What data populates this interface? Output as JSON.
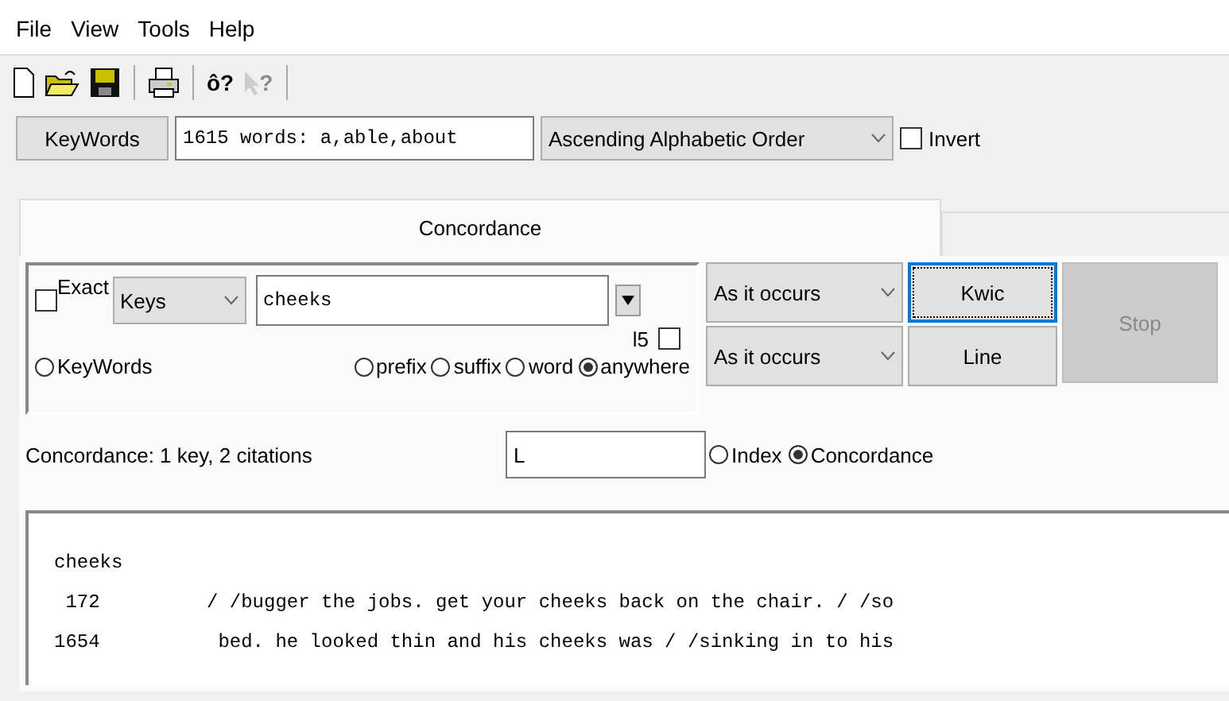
{
  "menu": [
    "File",
    "View",
    "Tools",
    "Help"
  ],
  "toolbar": [
    {
      "kind": "new"
    },
    {
      "kind": "open"
    },
    {
      "kind": "save"
    },
    {
      "kind": "sep"
    },
    {
      "kind": "print"
    },
    {
      "kind": "sep"
    },
    {
      "kind": "text",
      "label": "ô?"
    },
    {
      "kind": "help-pointer",
      "label": "?",
      "disabled": true
    },
    {
      "kind": "sep"
    }
  ],
  "keywords_bar": {
    "button": "KeyWords",
    "field": "1615 words: a,able,about",
    "order": "Ascending Alphabetic Order",
    "invert": {
      "label": "Invert",
      "checked": false
    }
  },
  "tabs": [
    {
      "label": "Concordance",
      "selected": true
    }
  ],
  "search": {
    "exact": {
      "label": "Exact",
      "checked": false
    },
    "scope": "Keys",
    "value": "cheeks",
    "limit": {
      "label": "l5",
      "checked": false
    },
    "keywords_radio": {
      "label": "KeyWords",
      "selected": false
    },
    "match": [
      {
        "label": "prefix",
        "selected": false
      },
      {
        "label": "suffix",
        "selected": false
      },
      {
        "label": "word",
        "selected": false
      },
      {
        "label": "anywhere",
        "selected": true
      }
    ]
  },
  "sort1": "As it occurs",
  "sort2": "As it occurs",
  "buttons": [
    {
      "label": "Kwic",
      "focused": true
    },
    {
      "label": "Line",
      "focused": false
    }
  ],
  "stop": {
    "label": "Stop",
    "disabled": true
  },
  "status": "Concordance: 1 key, 2 citations",
  "filter": "L",
  "view": [
    {
      "label": "Index",
      "selected": false
    },
    {
      "label": "Concordance",
      "selected": true
    }
  ],
  "output": {
    "key": "cheeks",
    "citations": [
      {
        "line": " 172",
        "text": "/ /bugger the jobs. get your cheeks back on the chair. / /so"
      },
      {
        "line": "1654",
        "text": " bed. he looked thin and his cheeks was / /sinking in to his"
      }
    ]
  }
}
